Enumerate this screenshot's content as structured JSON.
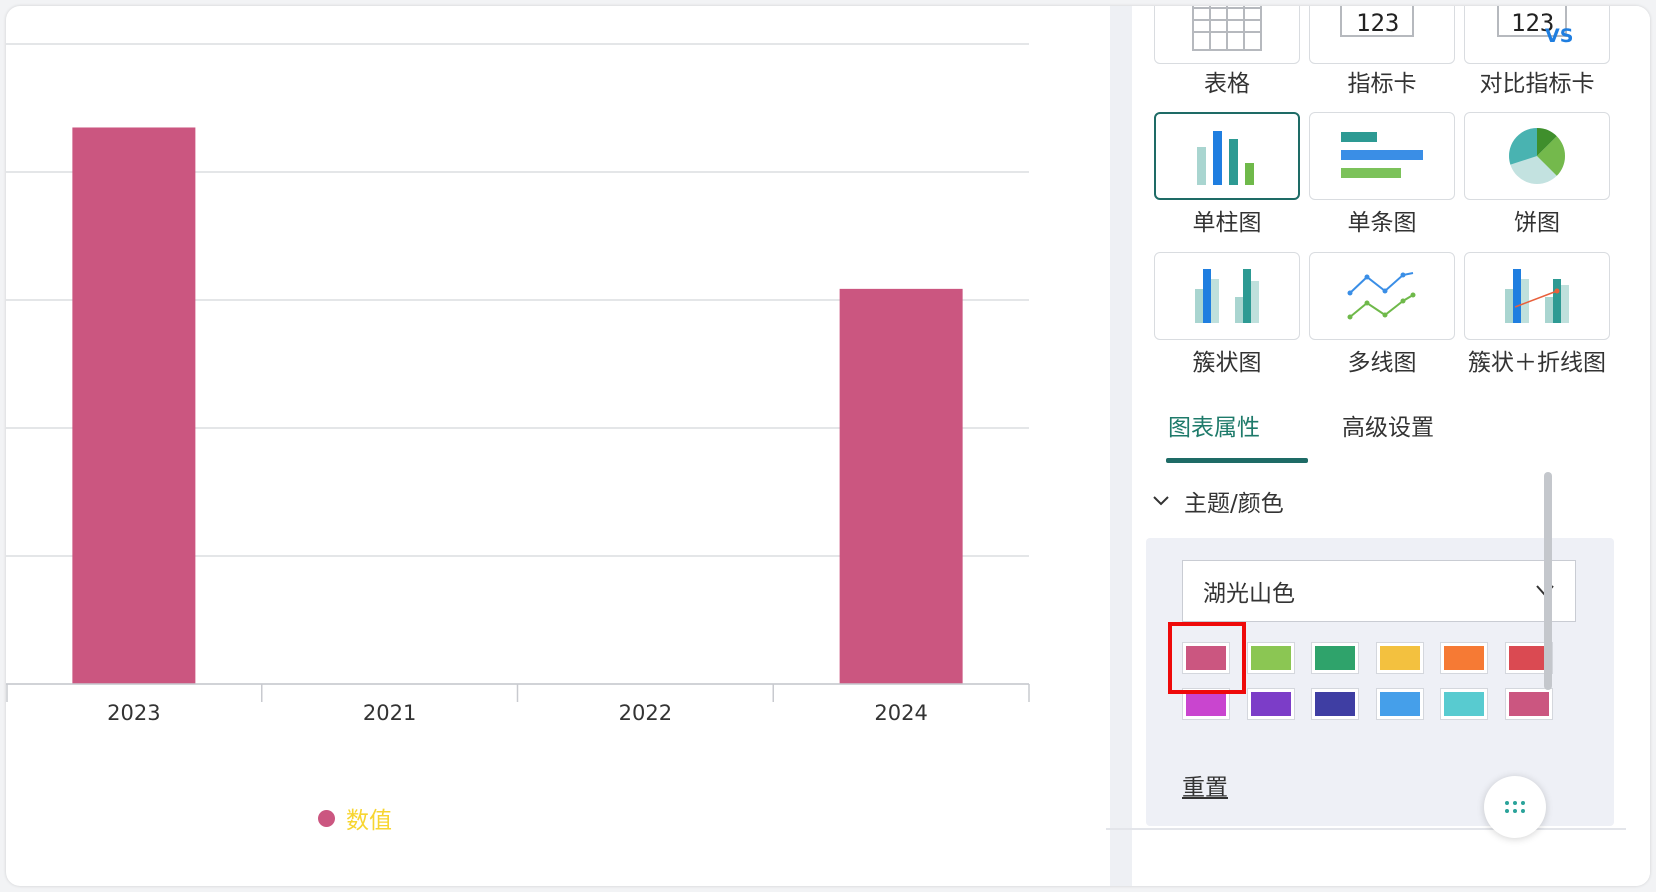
{
  "chart_data": {
    "type": "bar",
    "categories": [
      "2023",
      "2021",
      "2022",
      "2024"
    ],
    "series": [
      {
        "name": "数值",
        "values": [
          100,
          0,
          0,
          71
        ]
      }
    ],
    "ylim": [
      0,
      115
    ],
    "grid": true,
    "legend_position": "bottom-left",
    "color": "#cb5680"
  },
  "legend": {
    "label": "数值"
  },
  "chart_types": [
    {
      "label": "表格",
      "icon": "table-icon"
    },
    {
      "label": "指标卡",
      "icon": "kpi-card-icon",
      "number": "123"
    },
    {
      "label": "对比指标卡",
      "icon": "compare-kpi-icon",
      "number": "123",
      "vs": "VS"
    },
    {
      "label": "单柱图",
      "icon": "bar-chart-icon",
      "selected": true
    },
    {
      "label": "单条图",
      "icon": "horizontal-bar-icon"
    },
    {
      "label": "饼图",
      "icon": "pie-chart-icon"
    },
    {
      "label": "簇状图",
      "icon": "clustered-bar-icon"
    },
    {
      "label": "多线图",
      "icon": "multi-line-icon"
    },
    {
      "label": "簇状＋折线图",
      "icon": "combo-chart-icon"
    }
  ],
  "tabs": [
    {
      "label": "图表属性",
      "active": true
    },
    {
      "label": "高级设置",
      "active": false
    }
  ],
  "theme_section": {
    "title": "主题/颜色",
    "selected_theme": "湖光山色",
    "colors": [
      "#cb5680",
      "#8bc653",
      "#2fa36b",
      "#f3c13f",
      "#f67a34",
      "#da4a52",
      "#c945cf",
      "#7c3dc8",
      "#3f3ea3",
      "#459fea",
      "#58cbd0",
      "#cb5680"
    ],
    "reset_label": "重置"
  }
}
